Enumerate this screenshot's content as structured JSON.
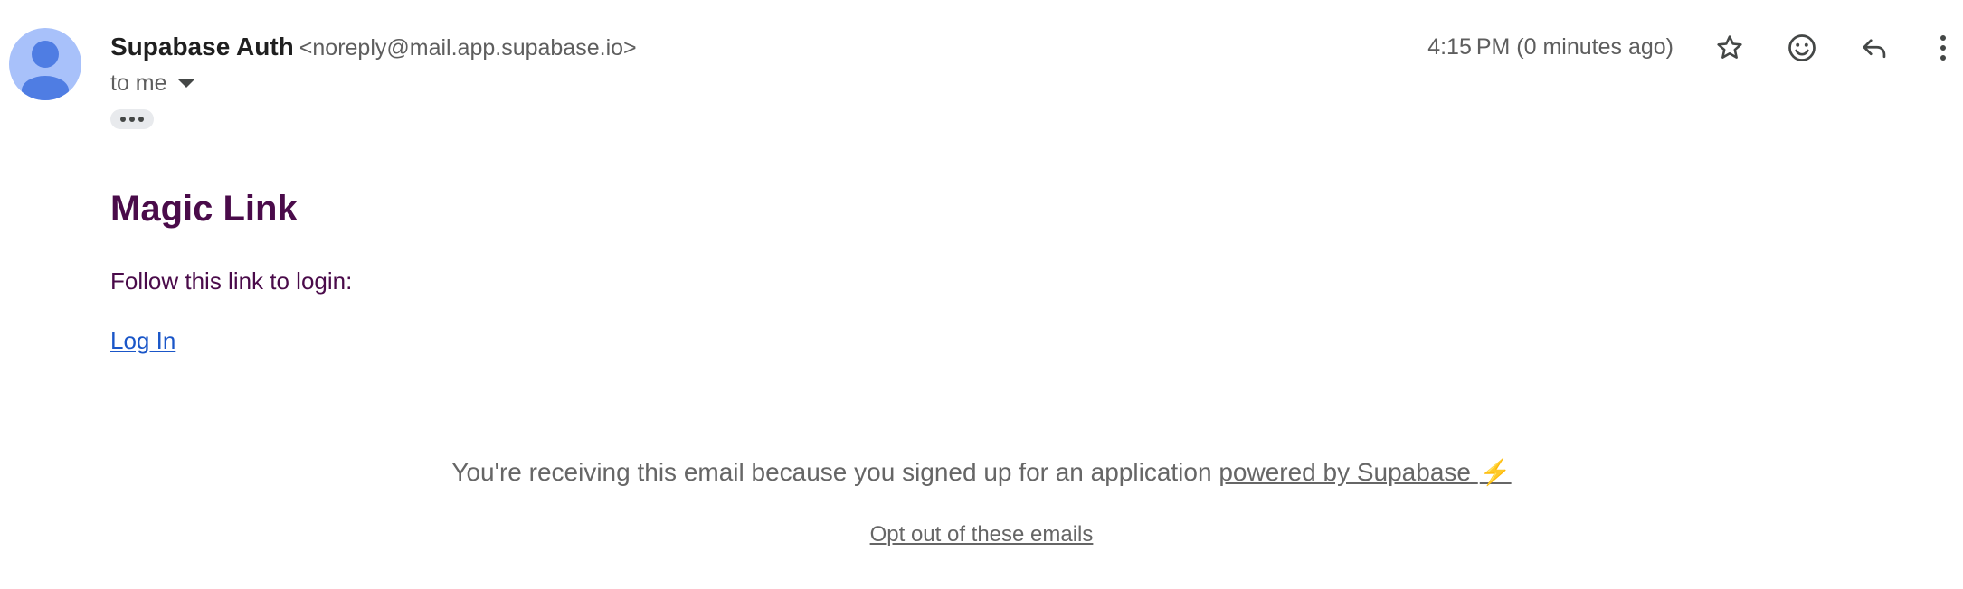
{
  "header": {
    "sender_name": "Supabase Auth",
    "sender_email": "<noreply@mail.app.supabase.io>",
    "recipient": "to me",
    "timestamp": "4:15 PM (0 minutes ago)",
    "icons": {
      "avatar": "person-avatar-icon",
      "star": "star-icon",
      "emoji": "emoji-reaction-icon",
      "reply": "reply-icon",
      "more": "more-vertical-icon",
      "show_trimmed": "ellipsis-icon",
      "recipient_details": "caret-down-icon"
    }
  },
  "body": {
    "title": "Magic Link",
    "instruction": "Follow this link to login:",
    "login_link": "Log In"
  },
  "footer": {
    "notice": "You're receiving this email because you signed up for an application",
    "powered_link": "powered by Supabase",
    "bolt": "⚡",
    "optout_link": "Opt out of these emails"
  },
  "colors": {
    "title": "#4a0b4a",
    "link": "#1a56c8",
    "footer_text": "#666666",
    "avatar_bg": "#a8c1fa",
    "avatar_fg": "#4f7de3"
  }
}
